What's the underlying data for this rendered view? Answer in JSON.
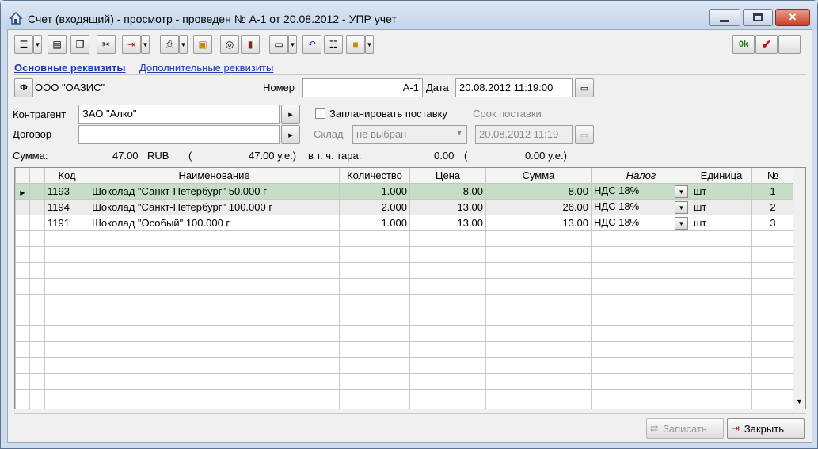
{
  "window": {
    "title": "Счет (входящий) - просмотр - проведен № А-1 от 20.08.2012 - УПР учет"
  },
  "toolbar": {
    "ok_label": "0k"
  },
  "tabs": [
    {
      "label": "Основные реквизиты"
    },
    {
      "label": "Дополнительные реквизиты"
    }
  ],
  "header": {
    "org_button": "Ф",
    "org_name": "ООО \"ОАЗИС\"",
    "number_label": "Номер",
    "number_value": "А-1",
    "date_label": "Дата",
    "date_value": "20.08.2012 11:19:00"
  },
  "form": {
    "contractor_label": "Контрагент",
    "contractor_value": "ЗАО \"Алко\"",
    "contract_label": "Договор",
    "contract_value": "",
    "plan_delivery_label": "Запланировать поставку",
    "delivery_term_label": "Срок поставки",
    "warehouse_label": "Склад",
    "warehouse_value": "не выбран",
    "delivery_date_value": "20.08.2012 11:19"
  },
  "totals": {
    "sum_label": "Сумма:",
    "sum_value": "47.00",
    "currency": "RUB",
    "open_paren": "(",
    "ue_value": "47.00 у.е.)",
    "tara_label": "в т. ч. тара:",
    "tara_value": "0.00",
    "tara_open": "(",
    "tara_ue": "0.00 у.е.)"
  },
  "table": {
    "columns": [
      "Код",
      "Наименование",
      "Количество",
      "Цена",
      "Сумма",
      "Налог",
      "Единица",
      "№"
    ],
    "rows": [
      {
        "code": "1193",
        "name": "Шоколад \"Санкт-Петербург\" 50.000 г",
        "qty": "1.000",
        "price": "8.00",
        "sum": "8.00",
        "tax": "НДС 18%",
        "unit": "шт",
        "num": "1"
      },
      {
        "code": "1194",
        "name": "Шоколад \"Санкт-Петербург\" 100.000 г",
        "qty": "2.000",
        "price": "13.00",
        "sum": "26.00",
        "tax": "НДС 18%",
        "unit": "шт",
        "num": "2"
      },
      {
        "code": "1191",
        "name": "Шоколад \"Особый\" 100.000 г",
        "qty": "1.000",
        "price": "13.00",
        "sum": "13.00",
        "tax": "НДС 18%",
        "unit": "шт",
        "num": "3"
      }
    ]
  },
  "footer": {
    "save_label": "Записать",
    "close_label": "Закрыть"
  },
  "colors": {
    "selected_row": "#c6ddc6",
    "link": "#1a3aa8",
    "ok_green": "#1f7a1f",
    "check_red": "#c0161a"
  },
  "icons": [
    "house-icon",
    "minimize-icon",
    "maximize-icon",
    "close-icon",
    "list-icon",
    "table-icon",
    "copy-icon",
    "scissors-icon",
    "export-icon",
    "printer-icon",
    "picture-icon",
    "coins-icon",
    "book-icon",
    "card-icon",
    "undo-icon",
    "columns-icon",
    "briefcase-icon",
    "ok-icon",
    "checkmark-icon",
    "save-icon",
    "exit-icon"
  ]
}
